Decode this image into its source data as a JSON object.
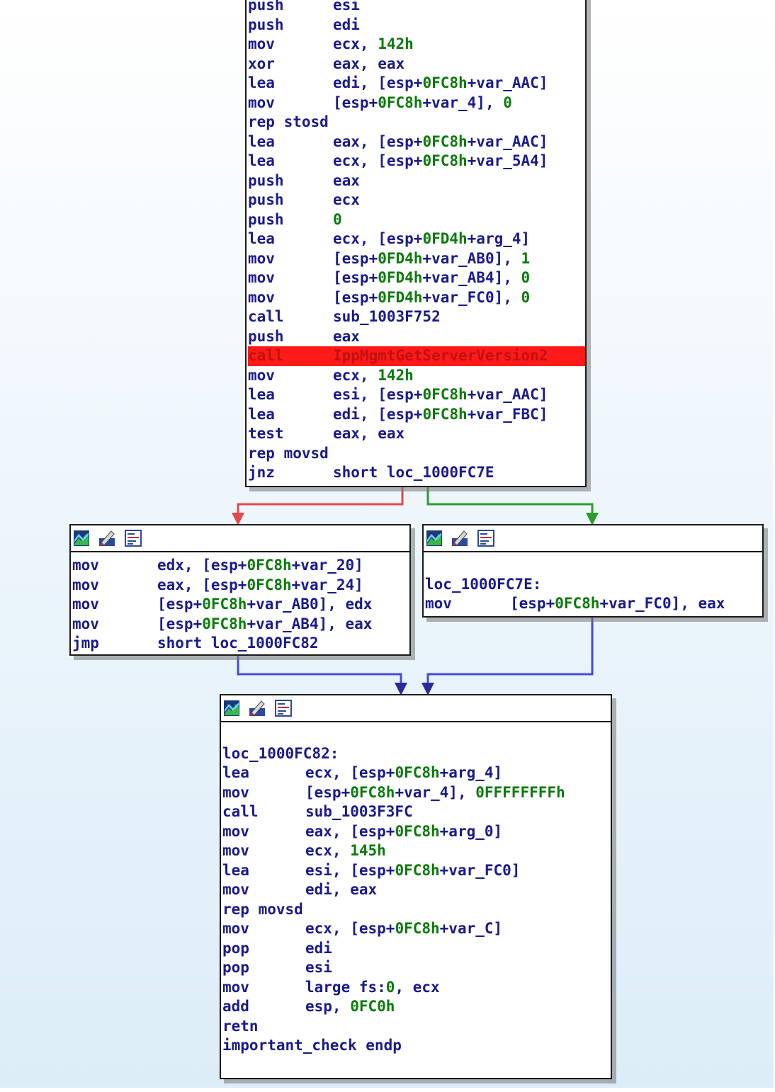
{
  "colors": {
    "instruction": "#1a1a8c",
    "number": "#0a7a0a",
    "highlight_bg": "#ff1a1a",
    "edge_false": "#e34a4a",
    "edge_true": "#2f9a2f",
    "edge_jump": "#4a4ad0"
  },
  "header_icons": [
    "graph-overview-icon",
    "edit-pencil-icon",
    "assembly-listing-icon"
  ],
  "blocks": {
    "top": {
      "lines": [
        {
          "m": "push",
          "ops": [
            {
              "t": "esi"
            }
          ]
        },
        {
          "m": "push",
          "ops": [
            {
              "t": "edi"
            }
          ]
        },
        {
          "m": "mov",
          "ops": [
            {
              "t": "ecx, "
            },
            {
              "t": "142h",
              "c": "num"
            }
          ]
        },
        {
          "m": "xor",
          "ops": [
            {
              "t": "eax, eax"
            }
          ]
        },
        {
          "m": "lea",
          "ops": [
            {
              "t": "edi, [esp+"
            },
            {
              "t": "0FC8h",
              "c": "num"
            },
            {
              "t": "+var_AAC]"
            }
          ]
        },
        {
          "m": "mov",
          "ops": [
            {
              "t": "[esp+"
            },
            {
              "t": "0FC8h",
              "c": "num"
            },
            {
              "t": "+var_4], "
            },
            {
              "t": "0",
              "c": "num"
            }
          ]
        },
        {
          "m": "rep stosd",
          "ops": []
        },
        {
          "m": "lea",
          "ops": [
            {
              "t": "eax, [esp+"
            },
            {
              "t": "0FC8h",
              "c": "num"
            },
            {
              "t": "+var_AAC]"
            }
          ]
        },
        {
          "m": "lea",
          "ops": [
            {
              "t": "ecx, [esp+"
            },
            {
              "t": "0FC8h",
              "c": "num"
            },
            {
              "t": "+var_5A4]"
            }
          ]
        },
        {
          "m": "push",
          "ops": [
            {
              "t": "eax"
            }
          ]
        },
        {
          "m": "push",
          "ops": [
            {
              "t": "ecx"
            }
          ]
        },
        {
          "m": "push",
          "ops": [
            {
              "t": "0",
              "c": "num"
            }
          ]
        },
        {
          "m": "lea",
          "ops": [
            {
              "t": "ecx, [esp+"
            },
            {
              "t": "0FD4h",
              "c": "num"
            },
            {
              "t": "+arg_4]"
            }
          ]
        },
        {
          "m": "mov",
          "ops": [
            {
              "t": "[esp+"
            },
            {
              "t": "0FD4h",
              "c": "num"
            },
            {
              "t": "+var_AB0], "
            },
            {
              "t": "1",
              "c": "num"
            }
          ]
        },
        {
          "m": "mov",
          "ops": [
            {
              "t": "[esp+"
            },
            {
              "t": "0FD4h",
              "c": "num"
            },
            {
              "t": "+var_AB4], "
            },
            {
              "t": "0",
              "c": "num"
            }
          ]
        },
        {
          "m": "mov",
          "ops": [
            {
              "t": "[esp+"
            },
            {
              "t": "0FD4h",
              "c": "num"
            },
            {
              "t": "+var_FC0], "
            },
            {
              "t": "0",
              "c": "num"
            }
          ]
        },
        {
          "m": "call",
          "ops": [
            {
              "t": "sub_1003F752"
            }
          ]
        },
        {
          "m": "push",
          "ops": [
            {
              "t": "eax"
            }
          ]
        },
        {
          "m": "call",
          "ops": [
            {
              "t": "IppMgmtGetServerVersion2"
            }
          ],
          "hl": true
        },
        {
          "m": "mov",
          "ops": [
            {
              "t": "ecx, "
            },
            {
              "t": "142h",
              "c": "num"
            }
          ]
        },
        {
          "m": "lea",
          "ops": [
            {
              "t": "esi, [esp+"
            },
            {
              "t": "0FC8h",
              "c": "num"
            },
            {
              "t": "+var_AAC]"
            }
          ]
        },
        {
          "m": "lea",
          "ops": [
            {
              "t": "edi, [esp+"
            },
            {
              "t": "0FC8h",
              "c": "num"
            },
            {
              "t": "+var_FBC]"
            }
          ]
        },
        {
          "m": "test",
          "ops": [
            {
              "t": "eax, eax"
            }
          ]
        },
        {
          "m": "rep movsd",
          "ops": []
        },
        {
          "m": "jnz",
          "ops": [
            {
              "t": "short loc_1000FC7E"
            }
          ]
        }
      ]
    },
    "left": {
      "lines": [
        {
          "m": "mov",
          "ops": [
            {
              "t": "edx, [esp+"
            },
            {
              "t": "0FC8h",
              "c": "num"
            },
            {
              "t": "+var_20]"
            }
          ]
        },
        {
          "m": "mov",
          "ops": [
            {
              "t": "eax, [esp+"
            },
            {
              "t": "0FC8h",
              "c": "num"
            },
            {
              "t": "+var_24]"
            }
          ]
        },
        {
          "m": "mov",
          "ops": [
            {
              "t": "[esp+"
            },
            {
              "t": "0FC8h",
              "c": "num"
            },
            {
              "t": "+var_AB0], edx"
            }
          ]
        },
        {
          "m": "mov",
          "ops": [
            {
              "t": "[esp+"
            },
            {
              "t": "0FC8h",
              "c": "num"
            },
            {
              "t": "+var_AB4], eax"
            }
          ]
        },
        {
          "m": "jmp",
          "ops": [
            {
              "t": "short loc_1000FC82"
            }
          ]
        }
      ]
    },
    "right": {
      "lines": [
        {
          "m": "",
          "ops": []
        },
        {
          "label": "loc_1000FC7E:"
        },
        {
          "m": "mov",
          "ops": [
            {
              "t": "[esp+"
            },
            {
              "t": "0FC8h",
              "c": "num"
            },
            {
              "t": "+var_FC0], eax"
            }
          ]
        }
      ]
    },
    "bottom": {
      "lines": [
        {
          "m": "",
          "ops": []
        },
        {
          "label": "loc_1000FC82:"
        },
        {
          "m": "lea",
          "ops": [
            {
              "t": "ecx, [esp+"
            },
            {
              "t": "0FC8h",
              "c": "num"
            },
            {
              "t": "+arg_4]"
            }
          ]
        },
        {
          "m": "mov",
          "ops": [
            {
              "t": "[esp+"
            },
            {
              "t": "0FC8h",
              "c": "num"
            },
            {
              "t": "+var_4], "
            },
            {
              "t": "0FFFFFFFFh",
              "c": "num"
            }
          ]
        },
        {
          "m": "call",
          "ops": [
            {
              "t": "sub_1003F3FC"
            }
          ]
        },
        {
          "m": "mov",
          "ops": [
            {
              "t": "eax, [esp+"
            },
            {
              "t": "0FC8h",
              "c": "num"
            },
            {
              "t": "+arg_0]"
            }
          ]
        },
        {
          "m": "mov",
          "ops": [
            {
              "t": "ecx, "
            },
            {
              "t": "145h",
              "c": "num"
            }
          ]
        },
        {
          "m": "lea",
          "ops": [
            {
              "t": "esi, [esp+"
            },
            {
              "t": "0FC8h",
              "c": "num"
            },
            {
              "t": "+var_FC0]"
            }
          ]
        },
        {
          "m": "mov",
          "ops": [
            {
              "t": "edi, eax"
            }
          ]
        },
        {
          "m": "rep movsd",
          "ops": []
        },
        {
          "m": "mov",
          "ops": [
            {
              "t": "ecx, [esp+"
            },
            {
              "t": "0FC8h",
              "c": "num"
            },
            {
              "t": "+var_C]"
            }
          ]
        },
        {
          "m": "pop",
          "ops": [
            {
              "t": "edi"
            }
          ]
        },
        {
          "m": "pop",
          "ops": [
            {
              "t": "esi"
            }
          ]
        },
        {
          "m": "mov",
          "ops": [
            {
              "t": "large fs:"
            },
            {
              "t": "0",
              "c": "num"
            },
            {
              "t": ", ecx"
            }
          ]
        },
        {
          "m": "add",
          "ops": [
            {
              "t": "esp, "
            },
            {
              "t": "0FC0h",
              "c": "num"
            }
          ]
        },
        {
          "m": "retn",
          "ops": []
        },
        {
          "label": "important_check endp"
        }
      ]
    }
  }
}
